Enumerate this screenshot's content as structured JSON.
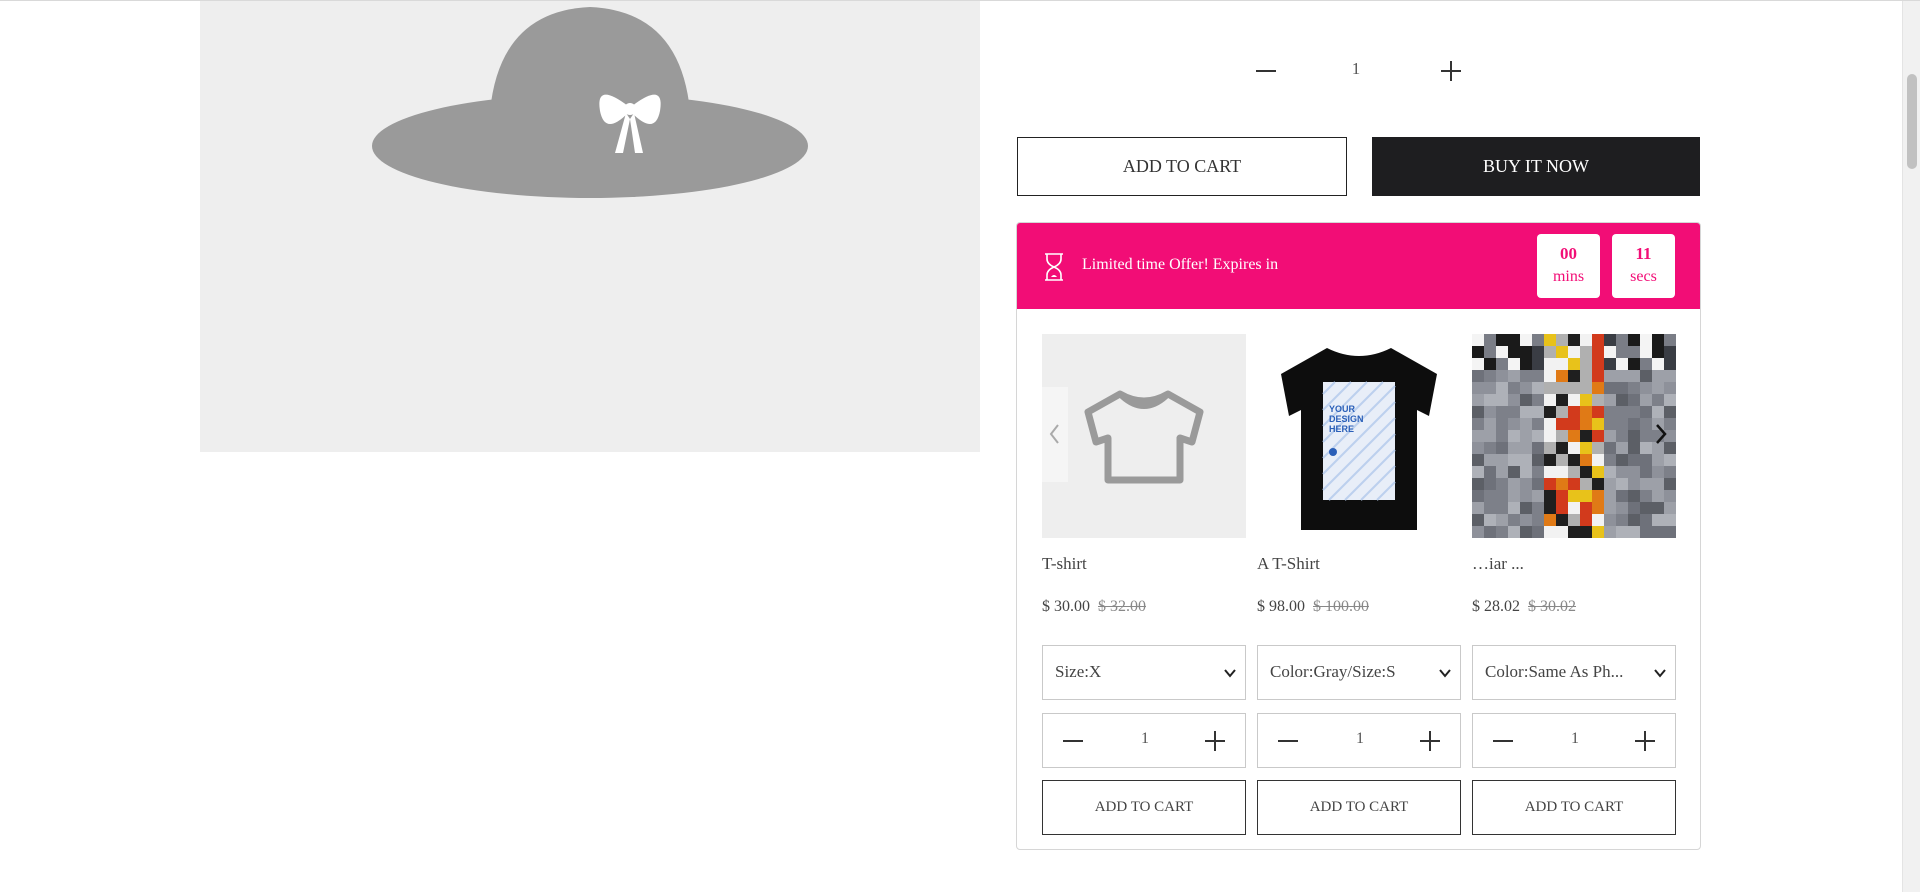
{
  "main_product": {
    "image_icon": "hat-icon",
    "quantity": "1",
    "add_to_cart_label": "ADD TO CART",
    "buy_now_label": "BUY IT NOW"
  },
  "offer": {
    "title": "Limited time Offer! Expires in",
    "icon": "hourglass-icon",
    "accent_color": "#f20d76",
    "minutes": "00",
    "minutes_label": "mins",
    "seconds": "11",
    "seconds_label": "secs"
  },
  "products": [
    {
      "name": "T-shirt",
      "price": "$ 30.00",
      "old_price": "$ 32.00",
      "variant": "Size:X",
      "quantity": "1",
      "add_label": "ADD TO CART",
      "image_icon": "tshirt-placeholder-icon"
    },
    {
      "name": "A T-Shirt",
      "price": "$ 98.00",
      "old_price": "$ 100.00",
      "variant": "Color:Gray/Size:S",
      "quantity": "1",
      "add_label": "ADD TO CART",
      "image_icon": "black-tshirt-design-icon",
      "design_text": "YOUR DESIGN HERE"
    },
    {
      "name": "…iar ...",
      "price": "$ 28.02",
      "old_price": "$ 30.02",
      "variant": "Color:Same As Ph...",
      "quantity": "1",
      "add_label": "ADD TO CART",
      "image_icon": "pixelated-photo-icon"
    }
  ]
}
